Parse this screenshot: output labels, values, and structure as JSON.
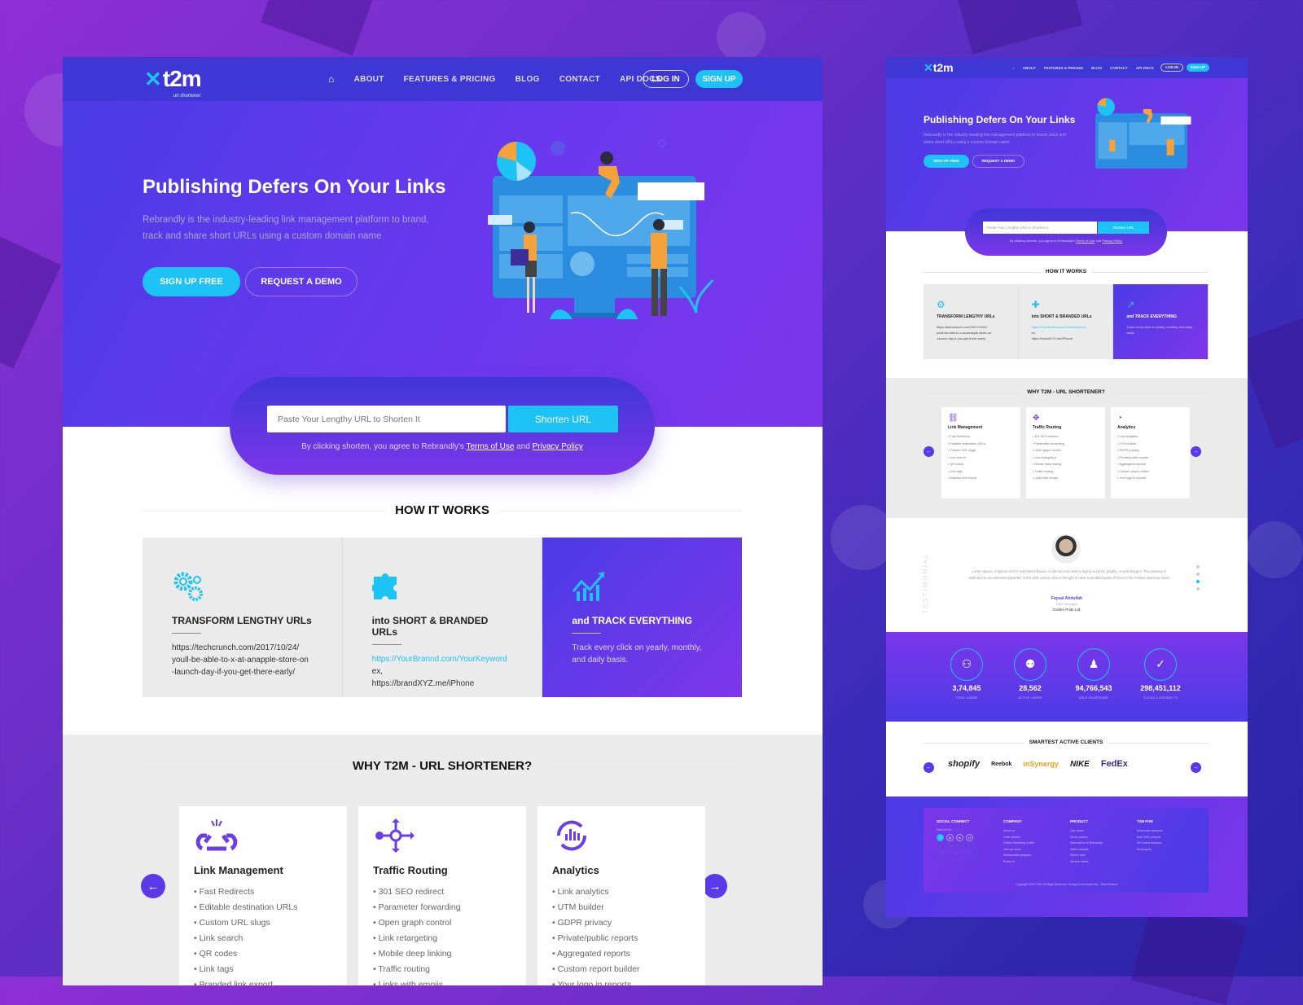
{
  "brand": {
    "name": "t2m",
    "tagline": "url shortener",
    "accent": "#1ec3f5",
    "primary": "#3f36d6",
    "secondary": "#7c36ea"
  },
  "nav": {
    "items": [
      "ABOUT",
      "FEATURES & PRICING",
      "BLOG",
      "CONTACT",
      "API DOCS"
    ],
    "login": "LOG IN",
    "signup": "SIGN UP"
  },
  "hero": {
    "title": "Publishing Defers On Your Links",
    "description": "Rebrandly is the industry-leading link management platform to brand, track and share short URLs using a custom domain name",
    "cta_primary": "SIGN UP FREE",
    "cta_secondary": "REQUEST A DEMO"
  },
  "shortener": {
    "placeholder": "Paste Your Lengthy URL to Shorten It",
    "button": "Shorten URL",
    "terms_prefix": "By clicking shorten, you agree to Rebrandly's ",
    "terms_link": "Terms of Use",
    "terms_and": " and ",
    "privacy_link": "Privacy Policy"
  },
  "how_it_works": {
    "title": "HOW IT WORKS",
    "cards": [
      {
        "title": "TRANSFORM LENGTHY URLs",
        "icon": "gears-icon",
        "lines": [
          "https://techcrunch.com/2017/10/24/",
          "youll-be-able-to-x-at-anapple-store-on",
          "-launch-day-if-you-get-there-early/"
        ]
      },
      {
        "title": "into SHORT & BRANDED URLs",
        "icon": "puzzle-icon",
        "link": "https://YourBrannd.com/YourKeyword",
        "lines": [
          "ex,",
          "https://brandXYZ.me/iPhone"
        ]
      },
      {
        "title": "and TRACK EVERYTHING",
        "icon": "growth-chart-icon",
        "lines": [
          "Track every click on yearly, monthly, and daily basis."
        ]
      }
    ]
  },
  "why": {
    "title": "WHY T2M - URL SHORTENER?",
    "features": [
      {
        "title": "Link Management",
        "icon": "broken-link-icon",
        "items": [
          "Fast Redirects",
          "Editable destination URLs",
          "Custom URL slugs",
          "Link search",
          "QR codes",
          "Link tags",
          "Branded link export"
        ]
      },
      {
        "title": "Traffic Routing",
        "icon": "routing-icon",
        "items": [
          "301 SEO redirect",
          "Parameter forwarding",
          "Open graph control",
          "Link retargeting",
          "Mobile deep linking",
          "Traffic routing",
          "Links with emojis"
        ]
      },
      {
        "title": "Analytics",
        "icon": "analytics-icon",
        "items": [
          "Link analytics",
          "UTM builder",
          "GDPR privacy",
          "Private/public reports",
          "Aggregated reports",
          "Custom report builder",
          "Your logo in reports"
        ]
      }
    ]
  },
  "testimonial": {
    "label": "TESTIMONIAL",
    "quote": "Lorem ipsum, or lipsum as it is sometimes known, is dummy text used in laying out print, graphic or web designs. The passage is attributed to an unknown typesetter in the 15th century who is thought to have scrambled parts of Cicero's De Finibus specimen book.",
    "name": "Faysal Abdullah",
    "role": "Asst. Manager",
    "company": "Golden Pride Ltd."
  },
  "stats": [
    {
      "value": "3,74,845",
      "label": "TOTAL USERS",
      "icon": "users-group-icon"
    },
    {
      "value": "28,562",
      "label": "ACTIVE USERS",
      "icon": "team-icon"
    },
    {
      "value": "94,766,543",
      "label": "URLS SHORTENED",
      "icon": "user-link-icon"
    },
    {
      "value": "298,451,112",
      "label": "CLICKS & REDIRECTS",
      "icon": "user-check-icon"
    }
  ],
  "clients": {
    "title": "SMARTEST ACTIVE CLIENTS",
    "logos": [
      "shopify",
      "Reebok",
      "inSynergy",
      "NIKE",
      "FedEx"
    ]
  },
  "footer": {
    "social": {
      "title": "SOCIAL CONNECT",
      "find": "Find Us On:",
      "store": "Google Play"
    },
    "columns": [
      {
        "title": "COMPANY",
        "items": [
          "About us",
          "Case studies",
          "Online Marketing Dublin",
          "Join our team",
          "Ambassador program",
          "Press kit"
        ]
      },
      {
        "title": "PRODUCT",
        "items": [
          "Use cases",
          "Demo (video)",
          "Alternatives to Rebrandly",
          "Video tutorials",
          "What's new",
          "Service status"
        ]
      },
      {
        "title": "T2M FOR",
        "items": [
          "Enterprise solutions",
          "Bulk SMS projects",
          "Get brand domains",
          "Developers"
        ]
      }
    ],
    "copyright": "Copyright 2020 T2M. All Right Reserved. Design & Developed by - Team Esteem"
  }
}
